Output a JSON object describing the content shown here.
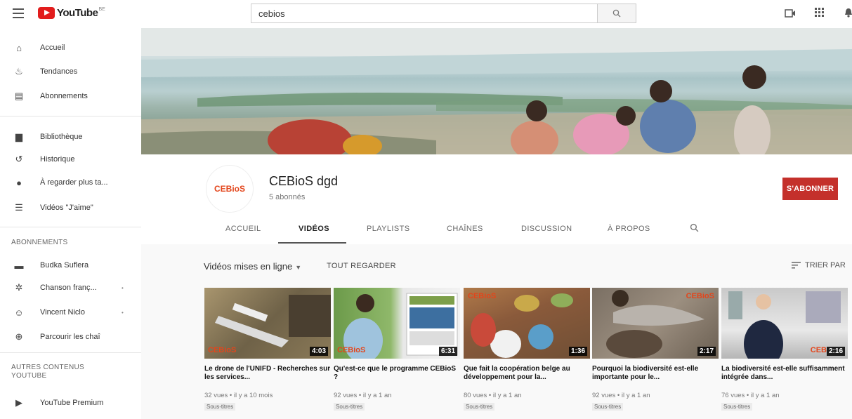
{
  "topbar": {
    "logo_text": "YouTube",
    "logo_sup": "BE",
    "search_value": "cebios"
  },
  "sidebar": {
    "main_items": [
      {
        "icon": "home-icon",
        "glyph": "⌂",
        "label": "Accueil"
      },
      {
        "icon": "trending-icon",
        "glyph": "♨",
        "label": "Tendances"
      },
      {
        "icon": "subscriptions-icon",
        "glyph": "▤",
        "label": "Abonnements"
      }
    ],
    "library_items": [
      {
        "icon": "library-icon",
        "glyph": "▆",
        "label": "Bibliothèque"
      },
      {
        "icon": "history-icon",
        "glyph": "↺",
        "label": "Historique"
      },
      {
        "icon": "watch-later-icon",
        "glyph": "●",
        "label": "À regarder plus ta..."
      },
      {
        "icon": "liked-videos-icon",
        "glyph": "☰",
        "label": "Vidéos \"J'aime\""
      }
    ],
    "subscriptions_heading": "ABONNEMENTS",
    "subscriptions": [
      {
        "icon": "channel-avatar-icon",
        "glyph": "▬",
        "label": "Budka Suflera",
        "dot": ""
      },
      {
        "icon": "channel-avatar-icon",
        "glyph": "✲",
        "label": "Chanson franç...",
        "dot": "•"
      },
      {
        "icon": "channel-avatar-icon",
        "glyph": "☺",
        "label": "Vincent Niclo",
        "dot": "•"
      },
      {
        "icon": "browse-channels-icon",
        "glyph": "⊕",
        "label": "Parcourir les chaî"
      }
    ],
    "more_heading": "AUTRES CONTENUS YOUTUBE",
    "more_items": [
      {
        "icon": "youtube-premium-icon",
        "glyph": "▶",
        "label": "YouTube Premium"
      }
    ]
  },
  "channel": {
    "avatar_text": "CEBioS",
    "name": "CEBioS dgd",
    "subscribers": "5 abonnés",
    "subscribe_label": "S'ABONNER",
    "tabs": [
      "ACCUEIL",
      "VIDÉOS",
      "PLAYLISTS",
      "CHAÎNES",
      "DISCUSSION",
      "À PROPOS"
    ],
    "active_tab": "VIDÉOS"
  },
  "videos_bar": {
    "filter_label": "Vidéos mises en ligne",
    "see_all": "TOUT REGARDER",
    "sort_label": "TRIER PAR"
  },
  "videos": [
    {
      "duration": "4:03",
      "brand": "CEBioS",
      "title": "Le drone de l'UNIFD - Recherches sur les services...",
      "meta": "32 vues • il y a 10 mois",
      "badge": "Sous-titres"
    },
    {
      "duration": "6:31",
      "brand": "CEBioS",
      "title": "Qu'est-ce que le programme CEBioS ?",
      "meta": "92 vues • il y a 1 an",
      "badge": "Sous-titres"
    },
    {
      "duration": "1:36",
      "brand": "CEBioS",
      "title": "Que fait la coopération belge au développement pour la...",
      "meta": "80 vues • il y a 1 an",
      "badge": "Sous-titres"
    },
    {
      "duration": "2:17",
      "brand": "CEBioS",
      "title": "Pourquoi la biodiversité est-elle importante pour le...",
      "meta": "92 vues • il y a 1 an",
      "badge": "Sous-titres"
    },
    {
      "duration": "2:16",
      "brand": "CEB",
      "title": "La biodiversité est-elle suffisamment intégrée dans...",
      "meta": "76 vues • il y a 1 an",
      "badge": "Sous-titres"
    }
  ],
  "colors": {
    "accent_red": "#c4302b",
    "brand_orange": "#e3451b"
  }
}
